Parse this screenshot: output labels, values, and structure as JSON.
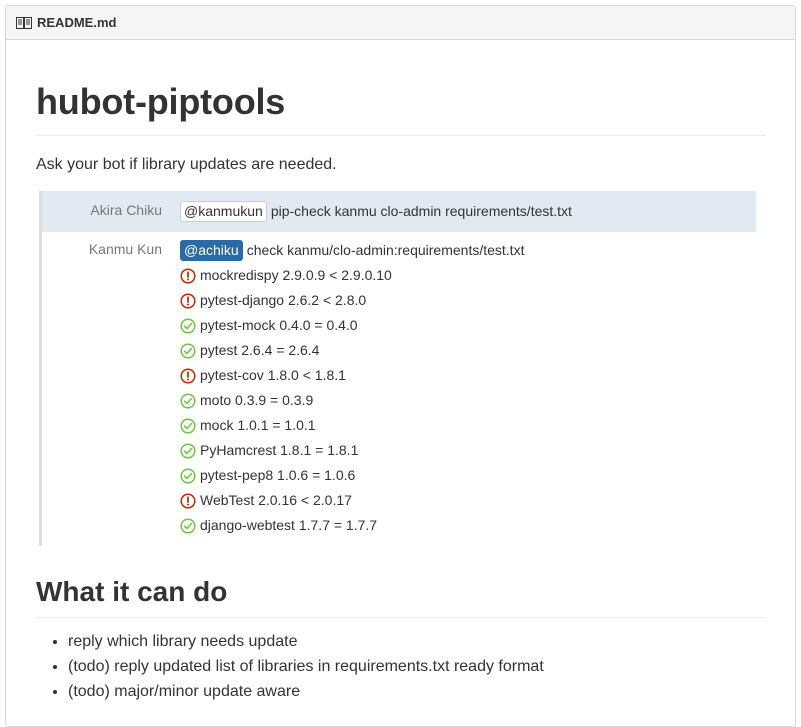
{
  "header": {
    "filename": "README.md",
    "icon": "book-icon"
  },
  "title": "hubot-piptools",
  "intro": "Ask your bot if library updates are needed.",
  "chat": {
    "messages": [
      {
        "author": "Akira Chiku",
        "mention": "@kanmukun",
        "text": "pip-check kanmu clo-admin requirements/test.txt"
      },
      {
        "author": "Kanmu Kun",
        "mention": "@achiku",
        "text": "check kanmu/clo-admin:requirements/test.txt",
        "results": [
          {
            "status": "outdated",
            "text": "mockredispy 2.9.0.9 < 2.9.0.10"
          },
          {
            "status": "outdated",
            "text": "pytest-django 2.6.2 < 2.8.0"
          },
          {
            "status": "ok",
            "text": "pytest-mock 0.4.0 = 0.4.0"
          },
          {
            "status": "ok",
            "text": "pytest 2.6.4 = 2.6.4"
          },
          {
            "status": "outdated",
            "text": "pytest-cov 1.8.0 < 1.8.1"
          },
          {
            "status": "ok",
            "text": "moto 0.3.9 = 0.3.9"
          },
          {
            "status": "ok",
            "text": "mock 1.0.1 = 1.0.1"
          },
          {
            "status": "ok",
            "text": "PyHamcrest 1.8.1 = 1.8.1"
          },
          {
            "status": "ok",
            "text": "pytest-pep8 1.0.6 = 1.0.6"
          },
          {
            "status": "outdated",
            "text": "WebTest 2.0.16 < 2.0.17"
          },
          {
            "status": "ok",
            "text": "django-webtest 1.7.7 = 1.7.7"
          }
        ]
      }
    ]
  },
  "section": {
    "title": "What it can do",
    "items": [
      "reply which library needs update",
      "(todo) reply updated list of libraries in requirements.txt ready format",
      "(todo) major/minor update aware"
    ]
  },
  "colors": {
    "ok": "#6cc644",
    "outdated": "#bd2c00",
    "mention_active": "#2a6aa7",
    "highlight": "#e1e9f2"
  }
}
